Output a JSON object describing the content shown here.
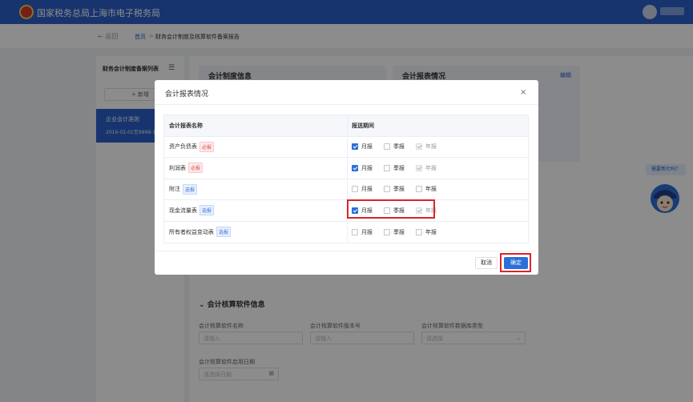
{
  "header": {
    "title": "国家税务总局上海市电子税务局"
  },
  "breadcrumb": {
    "back": "← 返回",
    "home": "首页",
    "sep": ">",
    "page": "财务会计制度及核算软件备案报告"
  },
  "sidebar": {
    "title": "财务会计制度备案列表",
    "add_label": "+ 新增",
    "item_name": "企业会计准则",
    "item_date": "2016-02-01至9999-1"
  },
  "main": {
    "card_a_title": "会计制度信息",
    "card_b_title": "会计报表情况",
    "card_b_edit": "编辑",
    "section_title": "会计核算软件信息",
    "fields": {
      "software_name_label": "会计核算软件名称",
      "software_name_ph": "请输入",
      "version_label": "会计核算软件版本号",
      "version_ph": "请输入",
      "db_label": "会计核算软件数据库类型",
      "db_ph": "请选择",
      "date_label": "会计核算软件启用日期",
      "date_ph": "请选择日期"
    }
  },
  "help": {
    "bubble": "需要帮忙吗？"
  },
  "modal": {
    "title": "会计报表情况",
    "close": "×",
    "col_name": "会计报表名称",
    "col_period": "报送期间",
    "options": [
      "月报",
      "季报",
      "年报"
    ],
    "rows": [
      {
        "name": "资产负债表",
        "tag": "必报",
        "tag_type": "req",
        "checks": [
          "on",
          "off",
          "dis"
        ]
      },
      {
        "name": "利润表",
        "tag": "必报",
        "tag_type": "req",
        "checks": [
          "on",
          "off",
          "dis"
        ]
      },
      {
        "name": "附注",
        "tag": "选报",
        "tag_type": "opt",
        "checks": [
          "off",
          "off",
          "off"
        ]
      },
      {
        "name": "现金流量表",
        "tag": "选报",
        "tag_type": "opt",
        "checks": [
          "on",
          "off",
          "dis"
        ]
      },
      {
        "name": "所有者权益变动表",
        "tag": "选报",
        "tag_type": "opt",
        "checks": [
          "off",
          "off",
          "off"
        ]
      }
    ],
    "cancel": "取消",
    "ok": "确定"
  }
}
